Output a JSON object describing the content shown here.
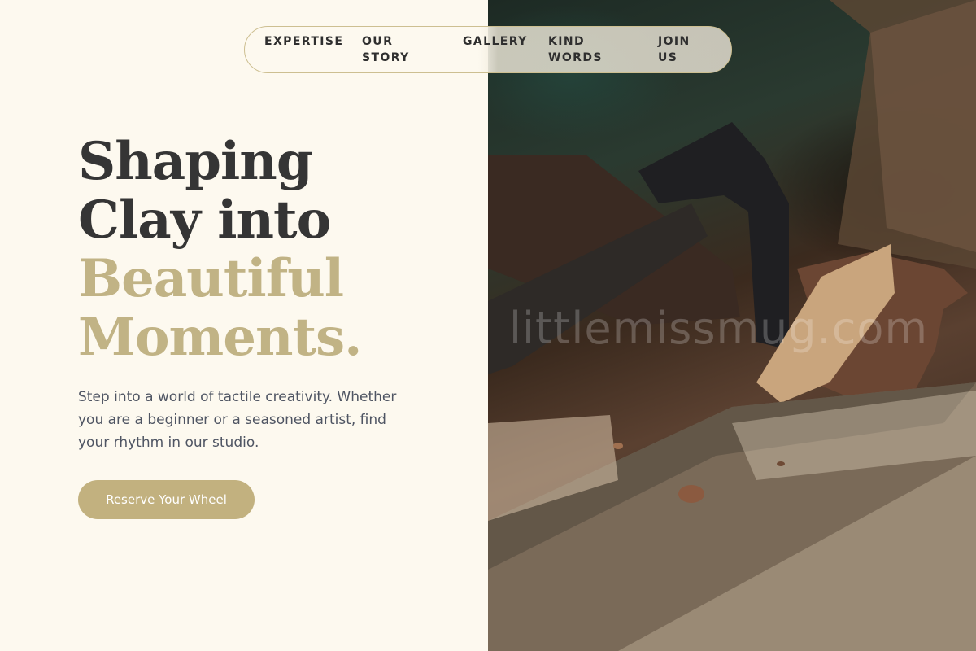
{
  "nav": {
    "items": [
      {
        "line1": "EXPERTISE",
        "line2": ""
      },
      {
        "line1": "OUR",
        "line2": "STORY"
      },
      {
        "line1": "GALLERY",
        "line2": ""
      },
      {
        "line1": "KIND",
        "line2": "WORDS"
      },
      {
        "line1": "JOIN",
        "line2": "US"
      }
    ]
  },
  "hero": {
    "headline_dark_1": "Shaping",
    "headline_dark_2": "Clay into",
    "headline_gold_1": "Beautiful",
    "headline_gold_2": "Moments.",
    "intro": "Step into a world of tactile creativity. Whether you are a beginner or a seasoned artist, find your rhythm in our studio.",
    "cta_label": "Reserve Your Wheel"
  },
  "image": {
    "watermark": "littlemissmug.com",
    "subject": "hands carving wood with a hand adze"
  },
  "colors": {
    "background": "#fdf9ef",
    "accent_gold": "#c1b385",
    "button": "#c2b17f",
    "heading_dark": "#353535",
    "body_text": "#4f5563"
  }
}
